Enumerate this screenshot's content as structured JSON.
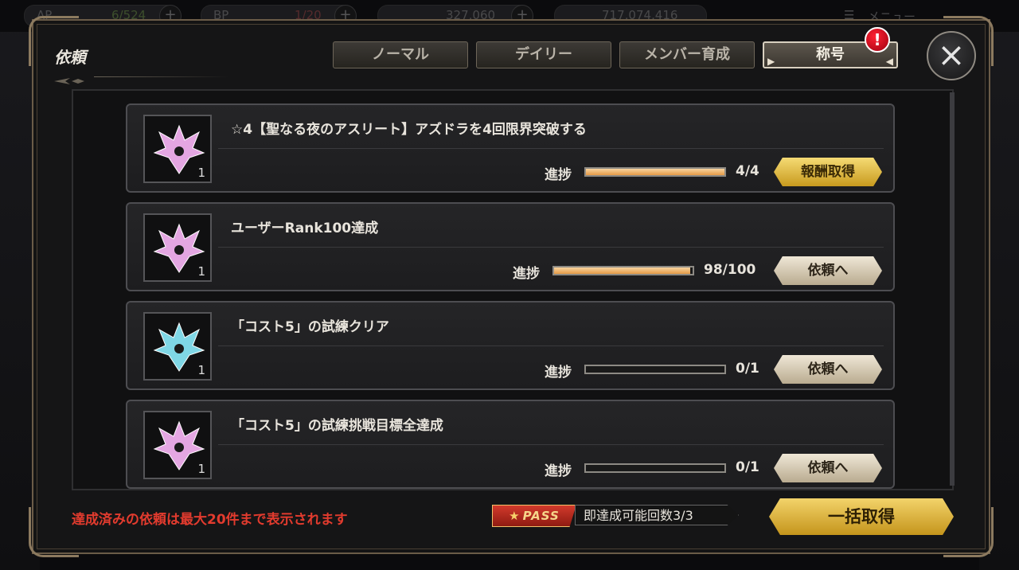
{
  "hud": {
    "ap_label": "AP",
    "ap_value": "6/524",
    "bp_label": "BP",
    "bp_value": "1/20",
    "currency1": "327,060",
    "currency2": "717,074,416",
    "menu_label": "メニュー"
  },
  "modal": {
    "title": "依頼",
    "tabs": [
      {
        "label": "ノーマル",
        "active": false
      },
      {
        "label": "デイリー",
        "active": false
      },
      {
        "label": "メンバー育成",
        "active": false
      },
      {
        "label": "称号",
        "active": true
      }
    ],
    "tab_badge": "!",
    "close_icon": "×"
  },
  "quests": [
    {
      "title": "☆4【聖なる夜のアスリート】アズドラを4回限界突破する",
      "progress_label": "進捗",
      "progress": 1.0,
      "count": "4/4",
      "button": "報酬取得",
      "button_type": "claim",
      "icon_color": "#e4a6e2",
      "icon_qty": "1"
    },
    {
      "title": "ユーザーRank100達成",
      "progress_label": "進捗",
      "progress": 0.98,
      "count": "98/100",
      "button": "依頼へ",
      "button_type": "go",
      "icon_color": "#e4a6e2",
      "icon_qty": "1"
    },
    {
      "title": "「コスト5」の試練クリア",
      "progress_label": "進捗",
      "progress": 0.0,
      "count": "0/1",
      "button": "依頼へ",
      "button_type": "go",
      "icon_color": "#7fd7e6",
      "icon_qty": "1"
    },
    {
      "title": "「コスト5」の試練挑戦目標全達成",
      "progress_label": "進捗",
      "progress": 0.0,
      "count": "0/1",
      "button": "依頼へ",
      "button_type": "go",
      "icon_color": "#e4a6e2",
      "icon_qty": "1"
    }
  ],
  "footer": {
    "note": "達成済みの依頼は最大20件まで表示されます",
    "pass_label": "PASS",
    "pass_counter": "即達成可能回数3/3",
    "claim_all": "一括取得"
  }
}
